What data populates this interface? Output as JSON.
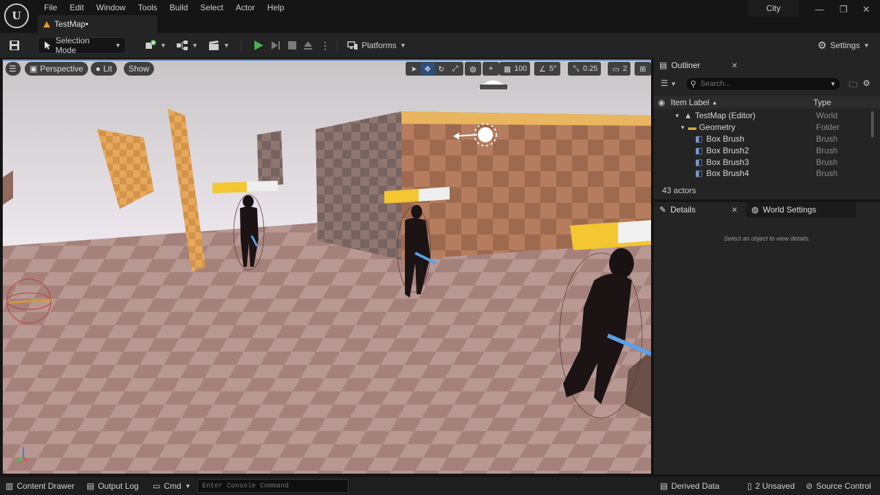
{
  "menu": [
    "File",
    "Edit",
    "Window",
    "Tools",
    "Build",
    "Select",
    "Actor",
    "Help"
  ],
  "map_tab": "TestMap•",
  "project": "City",
  "toolbar": {
    "selection_mode": "Selection Mode",
    "platforms": "Platforms",
    "settings": "Settings"
  },
  "viewport": {
    "perspective": "Perspective",
    "lit": "Lit",
    "show": "Show",
    "grid_snap": "100",
    "rotation_snap": "5°",
    "scale_snap": "0.25",
    "camera_speed": "2"
  },
  "outliner": {
    "title": "Outliner",
    "search_placeholder": "Search...",
    "col_label": "Item Label",
    "col_type": "Type",
    "rows": [
      {
        "label": "TestMap (Editor)",
        "type": "World"
      },
      {
        "label": "Geometry",
        "type": "Folder"
      },
      {
        "label": "Box Brush",
        "type": "Brush"
      },
      {
        "label": "Box Brush2",
        "type": "Brush"
      },
      {
        "label": "Box Brush3",
        "type": "Brush"
      },
      {
        "label": "Box Brush4",
        "type": "Brush"
      }
    ],
    "actor_count": "43 actors"
  },
  "details": {
    "title": "Details",
    "world_settings": "World Settings",
    "empty_message": "Select an object to view details."
  },
  "statusbar": {
    "content_drawer": "Content Drawer",
    "output_log": "Output Log",
    "cmd": "Cmd",
    "console_placeholder": "Enter Console Command",
    "derived_data": "Derived Data",
    "unsaved": "2 Unsaved",
    "source_control": "Source Control"
  },
  "colors": {
    "accent": "#2b6fbf",
    "warning": "#e69a2b",
    "play": "#4caf50"
  }
}
